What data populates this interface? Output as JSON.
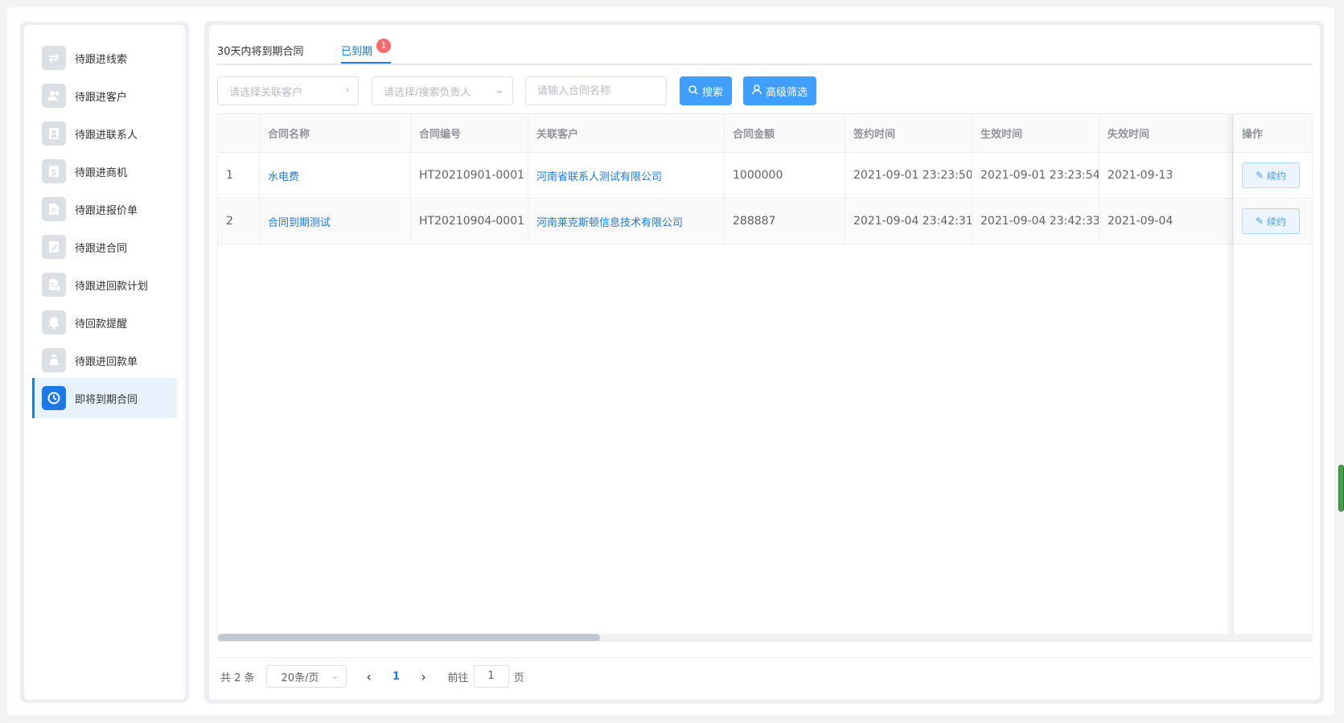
{
  "sidebar": {
    "items": [
      {
        "label": "待跟进线索",
        "icon": "transfer-icon",
        "glyph": "⇄"
      },
      {
        "label": "待跟进客户",
        "icon": "users-icon",
        "glyph": "👥"
      },
      {
        "label": "待跟进联系人",
        "icon": "contact-card-icon",
        "glyph": "▣"
      },
      {
        "label": "待跟进商机",
        "icon": "dollar-icon",
        "glyph": "$"
      },
      {
        "label": "待跟进报价单",
        "icon": "document-icon",
        "glyph": "≡"
      },
      {
        "label": "待跟进合同",
        "icon": "contract-icon",
        "glyph": "✎"
      },
      {
        "label": "待跟进回款计划",
        "icon": "payment-plan-icon",
        "glyph": "▤"
      },
      {
        "label": "待回款提醒",
        "icon": "bell-icon",
        "glyph": "🔔"
      },
      {
        "label": "待跟进回款单",
        "icon": "money-bag-icon",
        "glyph": "¥"
      },
      {
        "label": "即将到期合同",
        "icon": "clock-icon",
        "glyph": "◷"
      }
    ]
  },
  "tabs": {
    "tab1": "30天内将到期合同",
    "tab2": "已到期",
    "tab2_badge": "1"
  },
  "filters": {
    "customer_placeholder": "请选择关联客户",
    "owner_placeholder": "请选择/搜索负责人",
    "contract_placeholder": "请输入合同名称",
    "search_label": "搜索",
    "advanced_label": "高级筛选"
  },
  "table": {
    "columns": [
      "合同名称",
      "合同编号",
      "关联客户",
      "合同金额",
      "签约时间",
      "生效时间",
      "失效时间",
      "操作"
    ],
    "rows": [
      {
        "index": "1",
        "name": "水电费",
        "code": "HT20210901-0001",
        "customer": "河南省联系人测试有限公司",
        "amount": "1000000",
        "signed": "2021-09-01 23:23:50",
        "effective": "2021-09-01 23:23:54",
        "expire": "2021-09-13",
        "action": "续约"
      },
      {
        "index": "2",
        "name": "合同到期测试",
        "code": "HT20210904-0001",
        "customer": "河南莱克斯顿信息技术有限公司",
        "amount": "288887",
        "signed": "2021-09-04 23:42:31",
        "effective": "2021-09-04 23:42:33",
        "expire": "2021-09-04",
        "action": "续约"
      }
    ]
  },
  "pager": {
    "total": "共 2 条",
    "page_size": "20条/页",
    "current": "1",
    "goto_prefix": "前往",
    "goto_value": "1",
    "goto_suffix": "页"
  },
  "colors": {
    "accent": "#1b7ae4",
    "button": "#409eff",
    "badge": "#f56c6c"
  }
}
